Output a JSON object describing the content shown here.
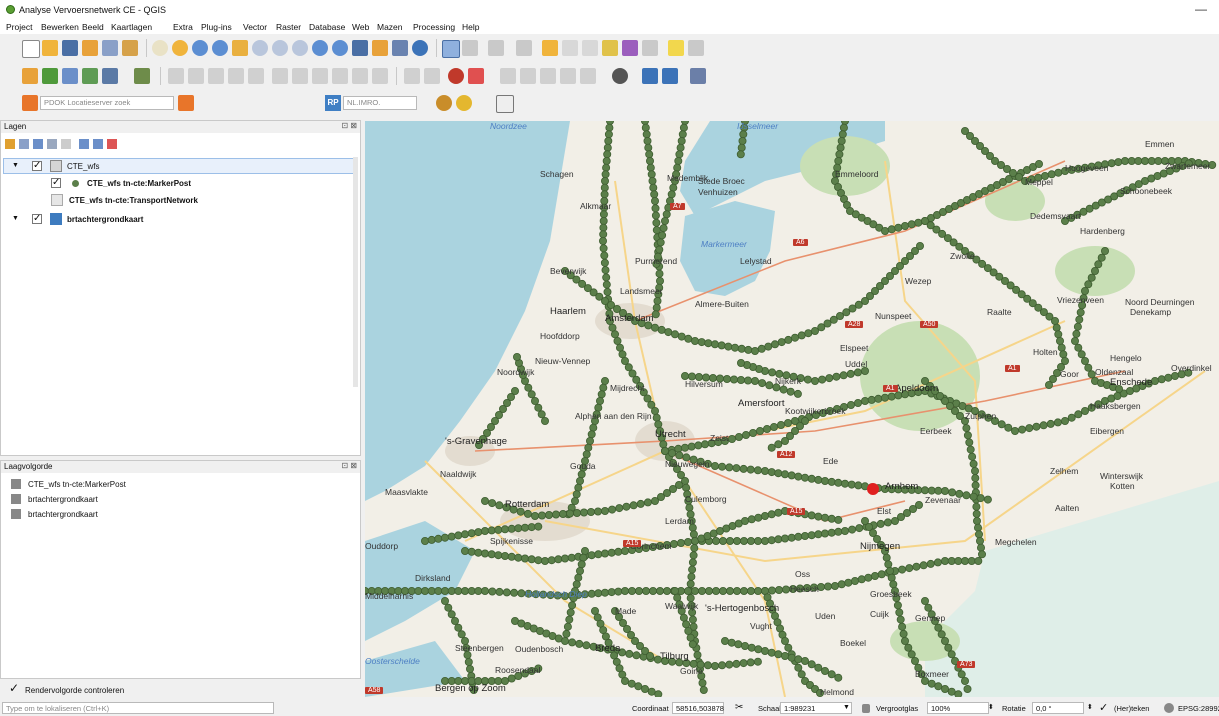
{
  "window": {
    "title": "Analyse Vervoersnetwerk CE - QGIS",
    "minimize": "—"
  },
  "menu": [
    "Project",
    "Bewerken",
    "Beeld",
    "Kaartlagen",
    "Extra",
    "Plug-ins",
    "Vector",
    "Raster",
    "Database",
    "Web",
    "Mazen",
    "Processing",
    "Help"
  ],
  "toolbar3": {
    "pdok_placeholder": "PDOK Locatieserver zoek",
    "rp_label": "RP",
    "nl_imro_placeholder": "NL.IMRO."
  },
  "layers_panel": {
    "title": "Lagen",
    "close": "⊡ ⊠",
    "items": [
      {
        "label": "CTE_wfs",
        "checked": true
      },
      {
        "label": "CTE_wfs tn-cte:MarkerPost",
        "checked": true
      },
      {
        "label": "CTE_wfs tn-cte:TransportNetwork",
        "checked": false
      },
      {
        "label": "brtachtergrondkaart",
        "checked": true
      }
    ]
  },
  "order_panel": {
    "title": "Laagvolgorde",
    "close": "⊡ ⊠",
    "items": [
      "CTE_wfs tn-cte:MarkerPost",
      "brtachtergrondkaart",
      "brtachtergrondkaart"
    ],
    "control_label": "Rendervolgorde controleren"
  },
  "map": {
    "labels": [
      {
        "t": "Noordzee",
        "cls": "water"
      },
      {
        "t": "IJsselmeer",
        "cls": "water"
      },
      {
        "t": "Markermeer",
        "cls": "water"
      },
      {
        "t": "Medemblik"
      },
      {
        "t": "Schagen"
      },
      {
        "t": "Stede Broec"
      },
      {
        "t": "Venhuizen"
      },
      {
        "t": "Emmeloord"
      },
      {
        "t": "Emmen"
      },
      {
        "t": "Zwartemeer"
      },
      {
        "t": "Hoogeveen"
      },
      {
        "t": "Schoonebeek"
      },
      {
        "t": "Meppel"
      },
      {
        "t": "Dedemsvaart"
      },
      {
        "t": "Hardenberg"
      },
      {
        "t": "Alkmaar"
      },
      {
        "t": "Purmerend"
      },
      {
        "t": "Lelystad"
      },
      {
        "t": "Beverwijk"
      },
      {
        "t": "Landsmeer"
      },
      {
        "t": "Zwolle"
      },
      {
        "t": "Wezep"
      },
      {
        "t": "Haarlem",
        "cls": "city"
      },
      {
        "t": "Amsterdam",
        "cls": "city"
      },
      {
        "t": "Almere-Buiten"
      },
      {
        "t": "Nunspeet"
      },
      {
        "t": "Raalte"
      },
      {
        "t": "Vriezenveen"
      },
      {
        "t": "Noord Deurningen"
      },
      {
        "t": "Denekamp"
      },
      {
        "t": "Hengelo"
      },
      {
        "t": "Oldenzaal"
      },
      {
        "t": "Hoofddorp"
      },
      {
        "t": "Nieuw-Vennep"
      },
      {
        "t": "Elspeet"
      },
      {
        "t": "Uddel"
      },
      {
        "t": "Holten"
      },
      {
        "t": "Noordwijk"
      },
      {
        "t": "Mijdrecht"
      },
      {
        "t": "Hilversum"
      },
      {
        "t": "Nijkerk"
      },
      {
        "t": "Apeldoorn",
        "cls": "city"
      },
      {
        "t": "Goor"
      },
      {
        "t": "Enschede",
        "cls": "city"
      },
      {
        "t": "Overdinkel"
      },
      {
        "t": "Alphen aan den Rijn"
      },
      {
        "t": "Amersfoort",
        "cls": "city"
      },
      {
        "t": "Kootwijkerbroek"
      },
      {
        "t": "Zutphen"
      },
      {
        "t": "Haaksbergen"
      },
      {
        "t": "'s-Gravenhage",
        "cls": "city"
      },
      {
        "t": "Utrecht",
        "cls": "city"
      },
      {
        "t": "Zeist"
      },
      {
        "t": "Eerbeek"
      },
      {
        "t": "Eibergen"
      },
      {
        "t": "Naaldwijk"
      },
      {
        "t": "Gouda"
      },
      {
        "t": "Nieuwegein"
      },
      {
        "t": "Ede"
      },
      {
        "t": "Zelhem"
      },
      {
        "t": "Winterswijk"
      },
      {
        "t": "Kotten"
      },
      {
        "t": "Maasvlakte"
      },
      {
        "t": "Rotterdam",
        "cls": "city"
      },
      {
        "t": "Culemborg"
      },
      {
        "t": "Arnhem",
        "cls": "city"
      },
      {
        "t": "Zevenaar"
      },
      {
        "t": "Aalten"
      },
      {
        "t": "Elst"
      },
      {
        "t": "Lerdam"
      },
      {
        "t": "Spijkenisse"
      },
      {
        "t": "Gorinchem"
      },
      {
        "t": "Nijmegen",
        "cls": "city"
      },
      {
        "t": "Megchelen"
      },
      {
        "t": "Ouddorp"
      },
      {
        "t": "Dirksland"
      },
      {
        "t": "Hollandsch Diep",
        "cls": "water"
      },
      {
        "t": "Oss"
      },
      {
        "t": "Heesch"
      },
      {
        "t": "Groesbeek"
      },
      {
        "t": "Middelharnis"
      },
      {
        "t": "Made"
      },
      {
        "t": "Waalwijk"
      },
      {
        "t": "'s-Hertogenbosch",
        "cls": "city"
      },
      {
        "t": "Cuijk"
      },
      {
        "t": "Vught"
      },
      {
        "t": "Uden"
      },
      {
        "t": "Gennep"
      },
      {
        "t": "Oosterschelde",
        "cls": "water"
      },
      {
        "t": "Steenbergen"
      },
      {
        "t": "Oudenbosch"
      },
      {
        "t": "Breda",
        "cls": "city"
      },
      {
        "t": "Tilburg",
        "cls": "city"
      },
      {
        "t": "Boekel"
      },
      {
        "t": "Roosendaal"
      },
      {
        "t": "Goirle"
      },
      {
        "t": "Boxmeer"
      },
      {
        "t": "Bergen op Zoom",
        "cls": "city"
      },
      {
        "t": "Helmond"
      }
    ],
    "shields": [
      "A7",
      "A6",
      "A28",
      "A50",
      "A1",
      "A1",
      "A12",
      "A15",
      "A15",
      "A73",
      "A58"
    ]
  },
  "status": {
    "search_placeholder": "Type om te lokaliseren (Ctrl+K)",
    "coord_label": "Coordinaat",
    "coord_value": "58516,503878",
    "scale_label": "Schaal",
    "scale_value": "1:989231",
    "magnifier_label": "Vergrootglas",
    "magnifier_value": "100%",
    "rotation_label": "Rotatie",
    "rotation_value": "0,0 °",
    "render_label": "(Her)teken",
    "crs": "EPSG:28992"
  },
  "colors": {
    "marker": "#5b7f4a",
    "marker_edge": "#3e5d30",
    "highlight": "#e02020",
    "water": "#aad3df",
    "land": "#f2efe7",
    "forest": "#c8dfb5",
    "urban": "#e3dcd0",
    "motorway": "#e8916d",
    "primary": "#f6d58a"
  }
}
